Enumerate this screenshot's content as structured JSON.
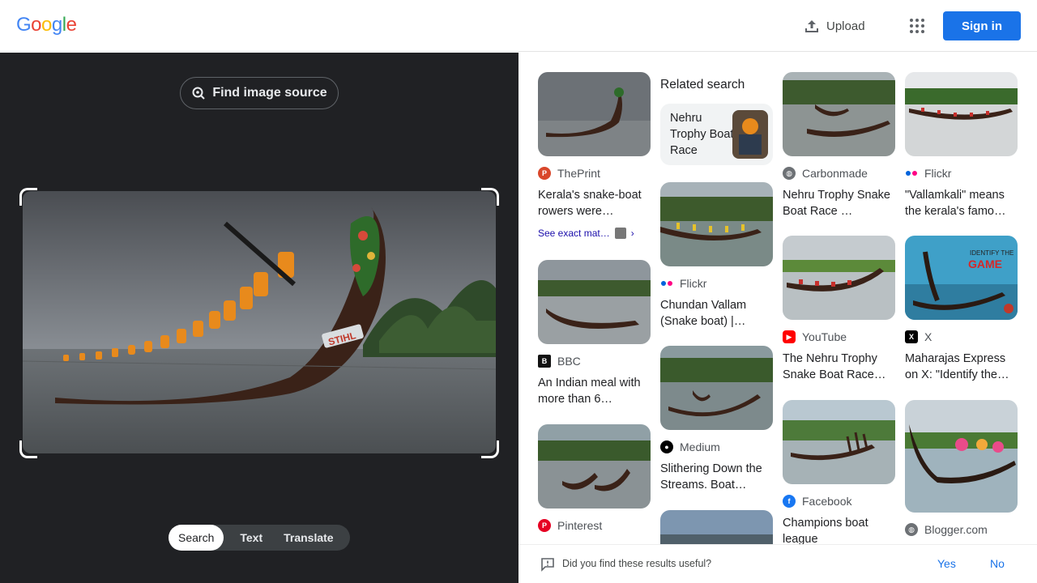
{
  "header": {
    "logo": "Google",
    "upload_label": "Upload",
    "signin_label": "Sign in"
  },
  "left": {
    "find_source_label": "Find image source",
    "modes": [
      "Search",
      "Text",
      "Translate"
    ],
    "active_mode": "Search",
    "photo_watermark": "STIHL"
  },
  "results": {
    "related_heading": "Related search",
    "related_query": "Nehru Trophy Boat Race",
    "cards": [
      {
        "source": "ThePrint",
        "title": "Kerala's snake-boat rowers were…",
        "exact": "See exact mat…"
      },
      {
        "source": "BBC",
        "title": "An Indian meal with more than 6…"
      },
      {
        "source": "Pinterest",
        "title": ""
      },
      {
        "source": "Flickr",
        "title": "Chundan Vallam (Snake boat) |…"
      },
      {
        "source": "Medium",
        "title": "Slithering Down the Streams. Boat…"
      },
      {
        "source": "Carbonmade",
        "title": "Nehru Trophy Snake Boat Race …"
      },
      {
        "source": "YouTube",
        "title": "The Nehru Trophy Snake Boat Race…"
      },
      {
        "source": "Facebook",
        "title": "Champions boat league"
      },
      {
        "source": "Flickr",
        "title": "\"Vallamkali\" means the kerala's famo…"
      },
      {
        "source": "X",
        "title": "Maharajas Express on X: \"Identify the…"
      },
      {
        "source": "Blogger.com",
        "title": ""
      }
    ],
    "identify_thumb_text": "IDENTIFY THE GAME"
  },
  "feedback": {
    "question": "Did you find these results useful?",
    "yes": "Yes",
    "no": "No"
  },
  "colors": {
    "google_blue": "#4285F4",
    "google_red": "#EA4335",
    "google_yellow": "#FBBC05",
    "google_green": "#34A853",
    "dark_pane": "#202124",
    "link_blue": "#1a73e8"
  }
}
